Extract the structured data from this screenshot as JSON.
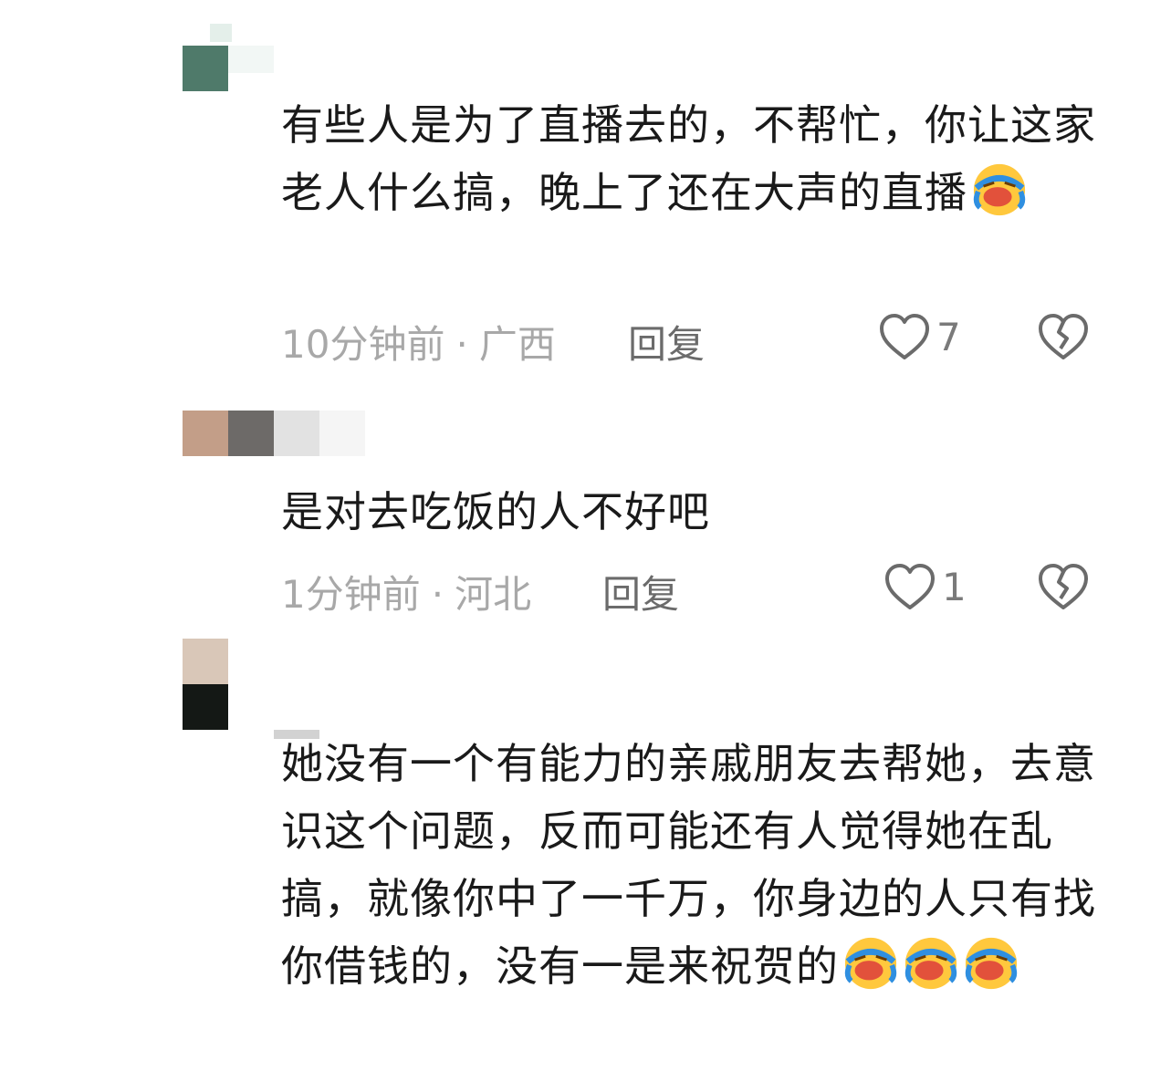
{
  "comments": [
    {
      "text": "有些人是为了直播去的，不帮忙，你让这家老人什么搞，晚上了还在大声的直播",
      "emojis": [
        "laugh-cry-emoji"
      ],
      "time": "10分钟前",
      "location": "广西",
      "reply_label": "回复",
      "like_count": "7"
    },
    {
      "text": "是对去吃饭的人不好吧",
      "emojis": [],
      "time": "1分钟前",
      "location": "河北",
      "reply_label": "回复",
      "like_count": "1"
    },
    {
      "text": "她没有一个有能力的亲戚朋友去帮她，去意识这个问题，反而可能还有人觉得她在乱搞，就像你中了一千万，你身边的人只有找你借钱的，没有一是来祝贺的",
      "emojis": [
        "laugh-cry-emoji",
        "laugh-cry-emoji",
        "laugh-cry-emoji"
      ],
      "time": "",
      "location": "",
      "reply_label": "",
      "like_count": ""
    }
  ],
  "separator": "·",
  "colors": {
    "text": "#1a1a1a",
    "meta": "#a8a8a8",
    "icon": "#6b6b6b"
  }
}
